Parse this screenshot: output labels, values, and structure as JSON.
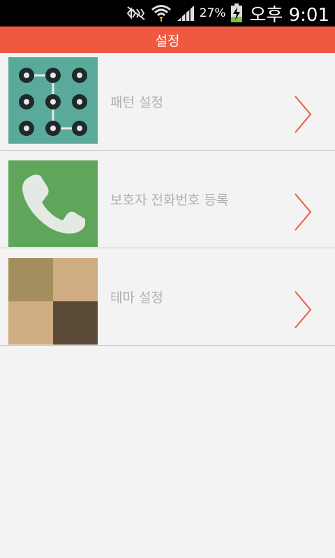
{
  "status_bar": {
    "battery_percent": "27%",
    "time": "오후 9:01",
    "icons": [
      "mute-icon",
      "wifi-icon",
      "signal-icon",
      "battery-charging-icon"
    ]
  },
  "app_bar": {
    "title": "설정"
  },
  "menu": {
    "items": [
      {
        "label": "패턴 설정",
        "icon": "pattern-lock-icon"
      },
      {
        "label": "보호자 전화번호 등록",
        "icon": "phone-icon"
      },
      {
        "label": "테마 설정",
        "icon": "theme-icon"
      }
    ]
  },
  "colors": {
    "accent": "#ee5940",
    "pattern_bg": "#5aaa9c",
    "phone_bg": "#5fa55c",
    "theme_tiles": [
      "#a38f5d",
      "#d0ac82",
      "#d0ac82",
      "#5c4c37"
    ]
  }
}
